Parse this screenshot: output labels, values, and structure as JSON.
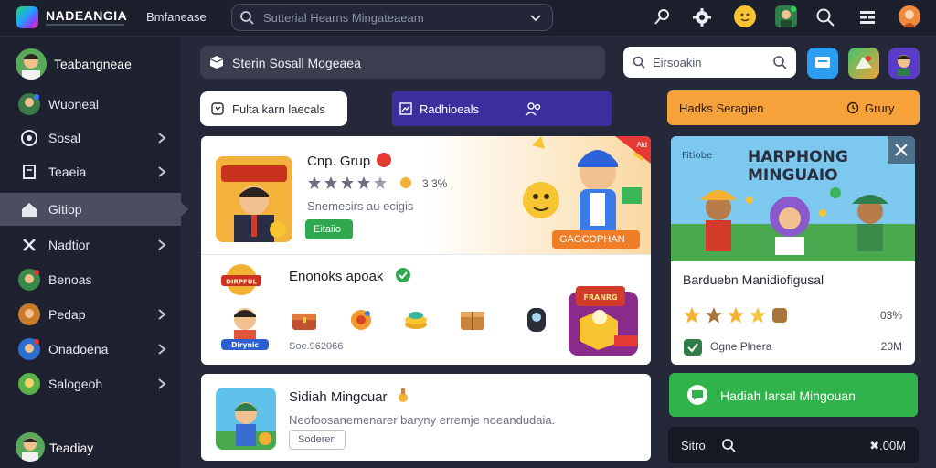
{
  "topbar": {
    "brand": "NADEANGIA",
    "link": "Bmfanease",
    "search_placeholder": "Sutterial Hearns Mingateaeam"
  },
  "sidebar": {
    "user_name": "Teabangneae",
    "items": [
      {
        "label": "Wuoneal"
      },
      {
        "label": "Sosal"
      },
      {
        "label": "Teaeia"
      },
      {
        "label": "Gitiop"
      },
      {
        "label": "Nadtior"
      },
      {
        "label": "Benoas"
      },
      {
        "label": "Pedap"
      },
      {
        "label": "Onadoena"
      },
      {
        "label": "Salogeoh"
      }
    ],
    "footer_label": "Teadiay"
  },
  "main": {
    "breadcrumb": "Sterin Sosall Mogeaea",
    "search_placeholder": "Eirsoakin",
    "filter_label": "Fulta karn laecals",
    "tab_label": "Radhioeals",
    "orange_label": "Hadks Seragien",
    "orange_right": "Grury"
  },
  "group_card": {
    "title": "Cnp. Grup",
    "rating_pct": "3 3%",
    "desc": "Snemesirs au ecigis",
    "button": "Eitaiio",
    "chip": "GAGCOPHAN",
    "ribbon": "Ald",
    "logo_text": "DIRPFUL",
    "section_title": "Enonoks apoak",
    "section_meta": "Soe.962066",
    "kid_label": "Dirynic",
    "gift_label": "FRANRG"
  },
  "list_card": {
    "title": "Sidiah Mingcuar",
    "desc": "Neofoosanemenarer baryny erremje noeandudaia.",
    "button": "Soderen"
  },
  "promo": {
    "tag": "Fitiobe",
    "art_title_1": "HARPHONG",
    "art_title_2": "MINGUAIO",
    "title": "Barduebn Manidiofigusal",
    "rating_pct": "03%",
    "foot_label": "Ogne Plnera",
    "foot_value": "20M"
  },
  "cta": {
    "label": "Hadiah Iarsal Mingouan"
  },
  "dark_bar": {
    "label": "Sitro",
    "value": "✖.00M"
  },
  "colors": {
    "background": "#242838",
    "sidebar": "#1e2130",
    "accent_purple": "#3b2f9e",
    "accent_orange": "#f7a13a",
    "accent_green": "#2fb34a"
  }
}
